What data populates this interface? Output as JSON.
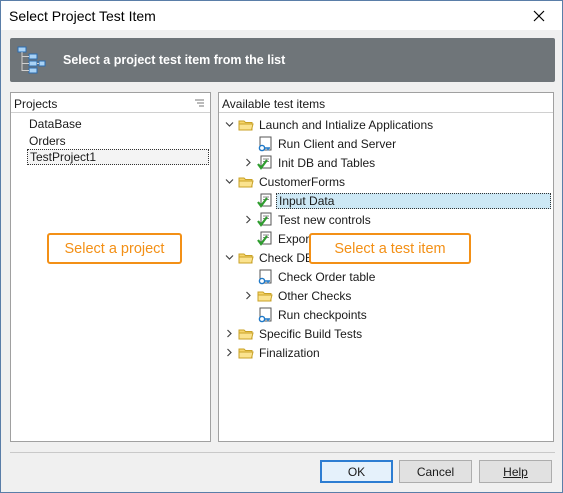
{
  "window": {
    "title": "Select Project Test Item",
    "banner_text": "Select a project test item from the list"
  },
  "projects_panel": {
    "header": "Projects",
    "items": [
      {
        "label": "DataBase",
        "selected": false
      },
      {
        "label": "Orders",
        "selected": false
      },
      {
        "label": "TestProject1",
        "selected": true
      }
    ]
  },
  "tests_panel": {
    "header": "Available test items",
    "items": [
      {
        "label": "Launch and Intialize Applications",
        "level": 0,
        "expander": "expanded",
        "icon": "folder-icon"
      },
      {
        "label": "Run Client and Server",
        "level": 1,
        "expander": "none",
        "icon": "keyword-test-icon"
      },
      {
        "label": "Init DB and Tables",
        "level": 1,
        "expander": "collapsed",
        "icon": "checked-test-icon"
      },
      {
        "label": "CustomerForms",
        "level": 0,
        "expander": "expanded",
        "icon": "folder-icon"
      },
      {
        "label": "Input Data",
        "level": 1,
        "expander": "none",
        "icon": "checked-test-icon",
        "selected": true
      },
      {
        "label": "Test new controls",
        "level": 1,
        "expander": "collapsed",
        "icon": "checked-test-icon"
      },
      {
        "label": "Export to Sh",
        "level": 1,
        "expander": "none",
        "icon": "checked-test-icon"
      },
      {
        "label": "Check DB D",
        "level": 0,
        "expander": "expanded",
        "icon": "folder-icon"
      },
      {
        "label": "Check Order table",
        "level": 1,
        "expander": "none",
        "icon": "keyword-test-icon"
      },
      {
        "label": "Other Checks",
        "level": 1,
        "expander": "collapsed",
        "icon": "folder-icon"
      },
      {
        "label": "Run checkpoints",
        "level": 1,
        "expander": "none",
        "icon": "keyword-test-icon"
      },
      {
        "label": "Specific Build Tests",
        "level": 0,
        "expander": "collapsed",
        "icon": "folder-icon"
      },
      {
        "label": "Finalization",
        "level": 0,
        "expander": "collapsed",
        "icon": "folder-icon"
      }
    ]
  },
  "callouts": {
    "projects": "Select a project",
    "tests": "Select a test item"
  },
  "buttons": {
    "ok": "OK",
    "cancel": "Cancel",
    "help": "Help"
  },
  "colors": {
    "accent_callout": "#f39016",
    "banner_bg": "#6f7579",
    "selection_bg": "#cde8f5",
    "ok_border": "#2d7dd2"
  }
}
